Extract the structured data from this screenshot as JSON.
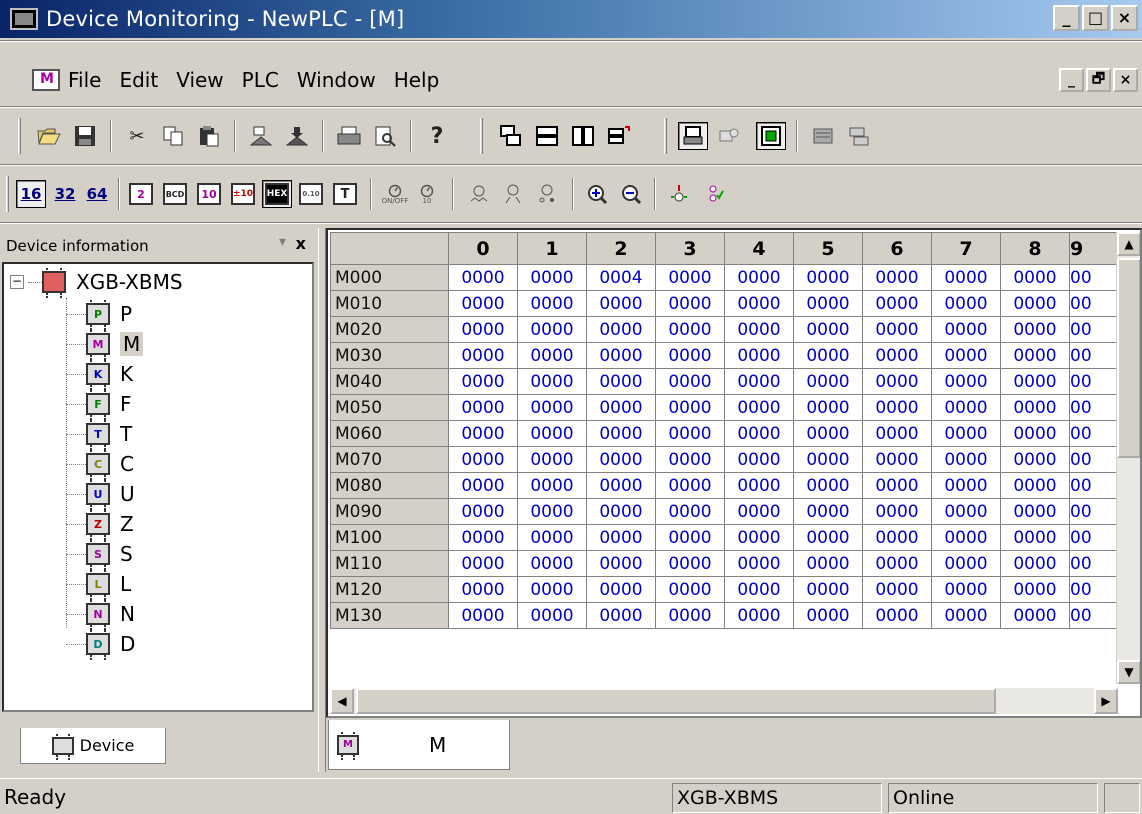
{
  "window": {
    "title": "Device Monitoring - NewPLC - [M]",
    "buttons": [
      "_",
      "□",
      "×"
    ]
  },
  "menubar": {
    "items": [
      "File",
      "Edit",
      "View",
      "PLC",
      "Window",
      "Help"
    ],
    "mdi_buttons": [
      "_",
      "🗗",
      "×"
    ]
  },
  "toolbar1": {
    "icons": [
      "open-icon",
      "save-icon",
      "cut-icon",
      "copy-icon",
      "paste-icon",
      "upload-icon",
      "download-icon",
      "print-icon",
      "print-preview-icon",
      "help-icon",
      "cascade-icon",
      "tile-horizontal-icon",
      "tile-vertical-icon",
      "arrange-icon",
      "connect-icon",
      "disconnect-icon",
      "monitor-icon",
      "write-icon",
      "settings-icon"
    ]
  },
  "toolbar2": {
    "format_labels": [
      "16",
      "32",
      "64",
      "2",
      "BCD",
      "10",
      "±10",
      "HEX",
      "0.10",
      "T"
    ],
    "other_labels": [
      "ON/OFF",
      "10"
    ]
  },
  "left_panel": {
    "header": "Device information",
    "pin": "▾",
    "close": "x",
    "root": {
      "label": "XGB-XBMS",
      "expander": "−",
      "chip": ""
    },
    "devices": [
      {
        "label": "P",
        "chip": "P",
        "color": "#008000"
      },
      {
        "label": "M",
        "chip": "M",
        "color": "#a000a0"
      },
      {
        "label": "K",
        "chip": "K",
        "color": "#0000c0"
      },
      {
        "label": "F",
        "chip": "F",
        "color": "#008000"
      },
      {
        "label": "T",
        "chip": "T",
        "color": "#0000c0"
      },
      {
        "label": "C",
        "chip": "C",
        "color": "#808000"
      },
      {
        "label": "U",
        "chip": "U",
        "color": "#0000c0"
      },
      {
        "label": "Z",
        "chip": "Z",
        "color": "#c00000"
      },
      {
        "label": "S",
        "chip": "S",
        "color": "#a000a0"
      },
      {
        "label": "L",
        "chip": "L",
        "color": "#808000"
      },
      {
        "label": "N",
        "chip": "N",
        "color": "#a000a0"
      },
      {
        "label": "D",
        "chip": "D",
        "color": "#008080"
      }
    ],
    "tab_label": "Device"
  },
  "grid": {
    "columns": [
      "0",
      "1",
      "2",
      "3",
      "4",
      "5",
      "6",
      "7",
      "8",
      "9"
    ],
    "rows": [
      {
        "addr": "M000",
        "values": [
          "0000",
          "0000",
          "0004",
          "0000",
          "0000",
          "0000",
          "0000",
          "0000",
          "0000",
          "00"
        ]
      },
      {
        "addr": "M010",
        "values": [
          "0000",
          "0000",
          "0000",
          "0000",
          "0000",
          "0000",
          "0000",
          "0000",
          "0000",
          "00"
        ]
      },
      {
        "addr": "M020",
        "values": [
          "0000",
          "0000",
          "0000",
          "0000",
          "0000",
          "0000",
          "0000",
          "0000",
          "0000",
          "00"
        ]
      },
      {
        "addr": "M030",
        "values": [
          "0000",
          "0000",
          "0000",
          "0000",
          "0000",
          "0000",
          "0000",
          "0000",
          "0000",
          "00"
        ]
      },
      {
        "addr": "M040",
        "values": [
          "0000",
          "0000",
          "0000",
          "0000",
          "0000",
          "0000",
          "0000",
          "0000",
          "0000",
          "00"
        ]
      },
      {
        "addr": "M050",
        "values": [
          "0000",
          "0000",
          "0000",
          "0000",
          "0000",
          "0000",
          "0000",
          "0000",
          "0000",
          "00"
        ]
      },
      {
        "addr": "M060",
        "values": [
          "0000",
          "0000",
          "0000",
          "0000",
          "0000",
          "0000",
          "0000",
          "0000",
          "0000",
          "00"
        ]
      },
      {
        "addr": "M070",
        "values": [
          "0000",
          "0000",
          "0000",
          "0000",
          "0000",
          "0000",
          "0000",
          "0000",
          "0000",
          "00"
        ]
      },
      {
        "addr": "M080",
        "values": [
          "0000",
          "0000",
          "0000",
          "0000",
          "0000",
          "0000",
          "0000",
          "0000",
          "0000",
          "00"
        ]
      },
      {
        "addr": "M090",
        "values": [
          "0000",
          "0000",
          "0000",
          "0000",
          "0000",
          "0000",
          "0000",
          "0000",
          "0000",
          "00"
        ]
      },
      {
        "addr": "M100",
        "values": [
          "0000",
          "0000",
          "0000",
          "0000",
          "0000",
          "0000",
          "0000",
          "0000",
          "0000",
          "00"
        ]
      },
      {
        "addr": "M110",
        "values": [
          "0000",
          "0000",
          "0000",
          "0000",
          "0000",
          "0000",
          "0000",
          "0000",
          "0000",
          "00"
        ]
      },
      {
        "addr": "M120",
        "values": [
          "0000",
          "0000",
          "0000",
          "0000",
          "0000",
          "0000",
          "0000",
          "0000",
          "0000",
          "00"
        ]
      },
      {
        "addr": "M130",
        "values": [
          "0000",
          "0000",
          "0000",
          "0000",
          "0000",
          "0000",
          "0000",
          "0000",
          "0000",
          "00"
        ]
      }
    ],
    "value_color": "#0000cc"
  },
  "doc_tab": {
    "label": "M"
  },
  "statusbar": {
    "text": "Ready",
    "plc": "XGB-XBMS",
    "mode": "Online"
  }
}
